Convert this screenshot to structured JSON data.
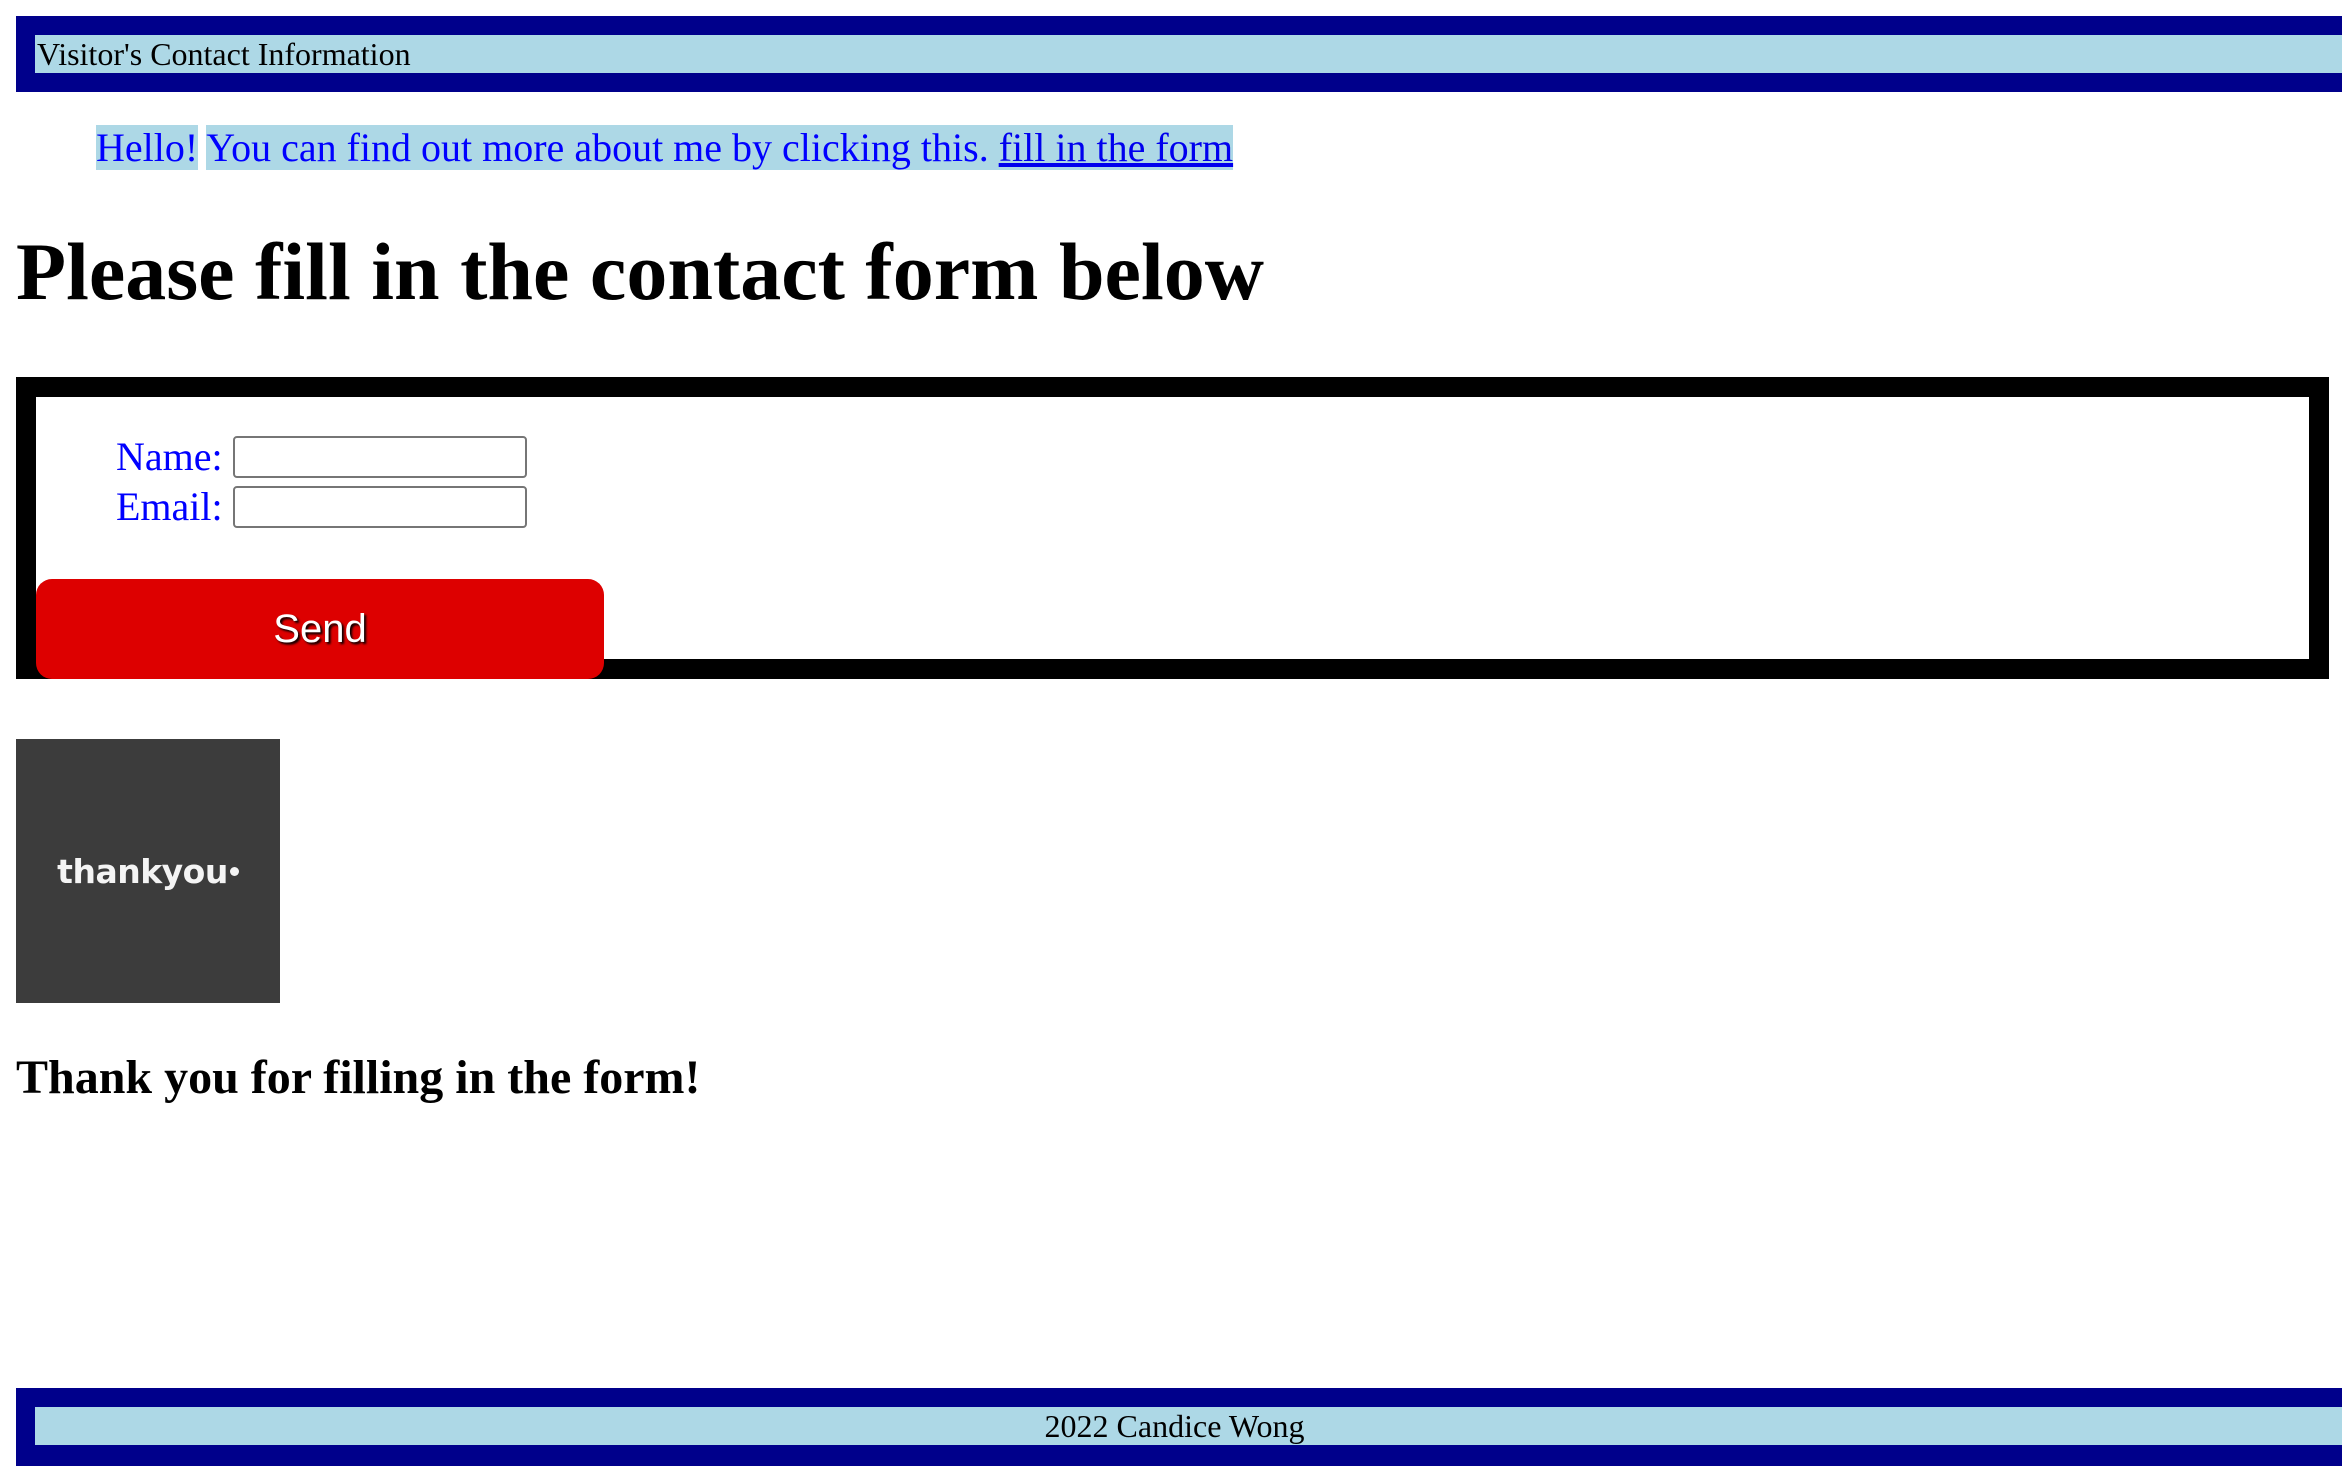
{
  "header": {
    "title": "Visitor's Contact Information"
  },
  "intro": {
    "greeting": "Hello!",
    "text": "You can find out more about me by clicking this.",
    "link_label": "fill in the form"
  },
  "page_title": "Please fill in the contact form below",
  "form": {
    "name_label": "Name:",
    "name_value": "",
    "email_label": "Email:",
    "email_value": "",
    "send_label": "Send"
  },
  "thanks_image": {
    "text": "thankyou"
  },
  "thanks_heading": "Thank you for filling in the form!",
  "footer": {
    "text": "2022 Candice Wong"
  },
  "colors": {
    "header_border": "#00008b",
    "header_fill": "#add8e6",
    "intro_text": "#0000ff",
    "send_button": "#dd0000",
    "image_bg": "#3c3c3c"
  }
}
